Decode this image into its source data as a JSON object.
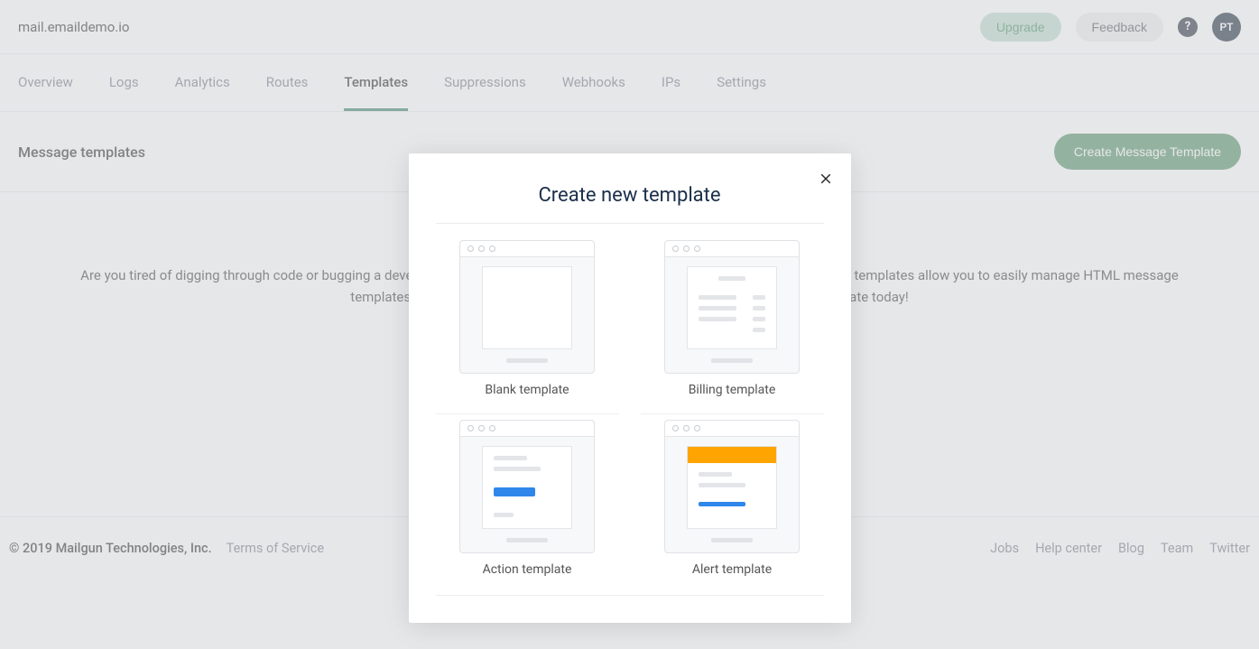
{
  "header": {
    "domain": "mail.emaildemo.io",
    "upgrade": "Upgrade",
    "feedback": "Feedback",
    "help_symbol": "?",
    "avatar_initials": "PT"
  },
  "nav": {
    "items": [
      {
        "label": "Overview",
        "active": false
      },
      {
        "label": "Logs",
        "active": false
      },
      {
        "label": "Analytics",
        "active": false
      },
      {
        "label": "Routes",
        "active": false
      },
      {
        "label": "Templates",
        "active": true
      },
      {
        "label": "Suppressions",
        "active": false
      },
      {
        "label": "Webhooks",
        "active": false
      },
      {
        "label": "IPs",
        "active": false
      },
      {
        "label": "Settings",
        "active": false
      }
    ]
  },
  "section": {
    "title": "Message templates",
    "create_button": "Create Message Template"
  },
  "content": {
    "blurb": "Are you tired of digging through code or bugging a developer anytime you need to make a content change to your email? Mailgun templates allow you to easily manage HTML message templates and make content changes without messing with the code. Build a template today!"
  },
  "footer": {
    "copyright": "© 2019 Mailgun Technologies, Inc.",
    "tos": "Terms of Service",
    "links": [
      "Jobs",
      "Help center",
      "Blog",
      "Team",
      "Twitter"
    ]
  },
  "modal": {
    "title": "Create new template",
    "options": [
      {
        "label": "Blank template",
        "variant": "blank"
      },
      {
        "label": "Billing template",
        "variant": "billing"
      },
      {
        "label": "Action template",
        "variant": "action"
      },
      {
        "label": "Alert template",
        "variant": "alert"
      }
    ]
  }
}
